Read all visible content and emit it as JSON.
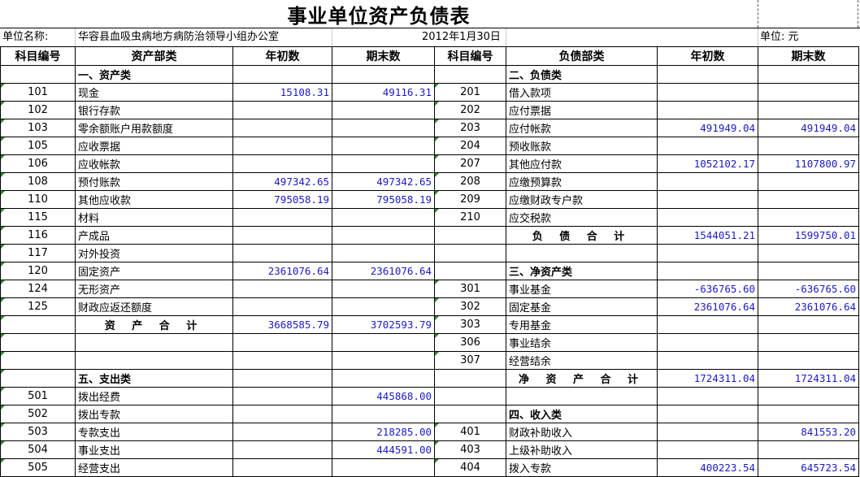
{
  "title": "事业单位资产负债表",
  "info": {
    "unit_label": "单位名称:",
    "unit_name": "华容县血吸虫病地方病防治领导小组办公室",
    "date": "2012年1月30日",
    "currency_label": "单位: 元"
  },
  "headers": [
    "科目编号",
    "资产部类",
    "年初数",
    "期末数",
    "科目编号",
    "负债部类",
    "年初数",
    "期末数"
  ],
  "rows": [
    [
      {
        "t": ""
      },
      {
        "t": "一、资产类",
        "s": "cat"
      },
      {
        "t": ""
      },
      {
        "t": ""
      },
      {
        "t": ""
      },
      {
        "t": "二、负债类",
        "s": "cat"
      },
      {
        "t": ""
      },
      {
        "t": ""
      }
    ],
    [
      {
        "t": "101",
        "s": "code"
      },
      {
        "t": "现金"
      },
      {
        "t": "15108.31",
        "s": "num"
      },
      {
        "t": "49116.31",
        "s": "num"
      },
      {
        "t": "201",
        "s": "code"
      },
      {
        "t": "借入款项"
      },
      {
        "t": ""
      },
      {
        "t": ""
      }
    ],
    [
      {
        "t": "102",
        "s": "code"
      },
      {
        "t": "银行存款"
      },
      {
        "t": ""
      },
      {
        "t": ""
      },
      {
        "t": "202",
        "s": "code"
      },
      {
        "t": "应付票据"
      },
      {
        "t": ""
      },
      {
        "t": ""
      }
    ],
    [
      {
        "t": "103",
        "s": "code"
      },
      {
        "t": "零余额账户用款额度"
      },
      {
        "t": ""
      },
      {
        "t": ""
      },
      {
        "t": "203",
        "s": "code"
      },
      {
        "t": "应付帐款"
      },
      {
        "t": "491949.04",
        "s": "num"
      },
      {
        "t": "491949.04",
        "s": "num"
      }
    ],
    [
      {
        "t": "105",
        "s": "code"
      },
      {
        "t": "应收票据"
      },
      {
        "t": ""
      },
      {
        "t": ""
      },
      {
        "t": "204",
        "s": "code"
      },
      {
        "t": "预收账款"
      },
      {
        "t": ""
      },
      {
        "t": ""
      }
    ],
    [
      {
        "t": "106",
        "s": "code"
      },
      {
        "t": "应收帐款"
      },
      {
        "t": ""
      },
      {
        "t": ""
      },
      {
        "t": "207",
        "s": "code"
      },
      {
        "t": "其他应付款"
      },
      {
        "t": "1052102.17",
        "s": "num"
      },
      {
        "t": "1107800.97",
        "s": "num"
      }
    ],
    [
      {
        "t": "108",
        "s": "code"
      },
      {
        "t": "预付账款"
      },
      {
        "t": "497342.65",
        "s": "num"
      },
      {
        "t": "497342.65",
        "s": "num"
      },
      {
        "t": "208",
        "s": "code"
      },
      {
        "t": "应缴预算款"
      },
      {
        "t": ""
      },
      {
        "t": ""
      }
    ],
    [
      {
        "t": "110",
        "s": "code"
      },
      {
        "t": "其他应收款"
      },
      {
        "t": "795058.19",
        "s": "num"
      },
      {
        "t": "795058.19",
        "s": "num"
      },
      {
        "t": "209",
        "s": "code"
      },
      {
        "t": "应缴财政专户款"
      },
      {
        "t": ""
      },
      {
        "t": ""
      }
    ],
    [
      {
        "t": "115",
        "s": "code"
      },
      {
        "t": "材料"
      },
      {
        "t": ""
      },
      {
        "t": ""
      },
      {
        "t": "210",
        "s": "code"
      },
      {
        "t": "应交税款"
      },
      {
        "t": ""
      },
      {
        "t": ""
      }
    ],
    [
      {
        "t": "116",
        "s": "code"
      },
      {
        "t": "产成品"
      },
      {
        "t": ""
      },
      {
        "t": ""
      },
      {
        "t": ""
      },
      {
        "t": "负 债 合 计",
        "s": "total"
      },
      {
        "t": "1544051.21",
        "s": "num"
      },
      {
        "t": "1599750.01",
        "s": "num"
      }
    ],
    [
      {
        "t": "117",
        "s": "code"
      },
      {
        "t": "对外投资"
      },
      {
        "t": ""
      },
      {
        "t": ""
      },
      {
        "t": ""
      },
      {
        "t": ""
      },
      {
        "t": ""
      },
      {
        "t": ""
      }
    ],
    [
      {
        "t": "120",
        "s": "code"
      },
      {
        "t": "固定资产"
      },
      {
        "t": "2361076.64",
        "s": "num"
      },
      {
        "t": "2361076.64",
        "s": "num"
      },
      {
        "t": ""
      },
      {
        "t": "三、净资产类",
        "s": "cat"
      },
      {
        "t": ""
      },
      {
        "t": ""
      }
    ],
    [
      {
        "t": "124",
        "s": "code"
      },
      {
        "t": "无形资产"
      },
      {
        "t": ""
      },
      {
        "t": ""
      },
      {
        "t": "301",
        "s": "code"
      },
      {
        "t": "事业基金"
      },
      {
        "t": "-636765.60",
        "s": "num"
      },
      {
        "t": "-636765.60",
        "s": "num"
      }
    ],
    [
      {
        "t": "125",
        "s": "code"
      },
      {
        "t": "财政应返还额度"
      },
      {
        "t": ""
      },
      {
        "t": ""
      },
      {
        "t": "302",
        "s": "code"
      },
      {
        "t": "固定基金"
      },
      {
        "t": "2361076.64",
        "s": "num"
      },
      {
        "t": "2361076.64",
        "s": "num"
      }
    ],
    [
      {
        "t": ""
      },
      {
        "t": "资 产 合 计",
        "s": "total"
      },
      {
        "t": "3668585.79",
        "s": "num"
      },
      {
        "t": "3702593.79",
        "s": "num"
      },
      {
        "t": "303",
        "s": "code"
      },
      {
        "t": "专用基金"
      },
      {
        "t": ""
      },
      {
        "t": ""
      }
    ],
    [
      {
        "t": ""
      },
      {
        "t": ""
      },
      {
        "t": ""
      },
      {
        "t": ""
      },
      {
        "t": "306",
        "s": "code"
      },
      {
        "t": "事业结余"
      },
      {
        "t": ""
      },
      {
        "t": ""
      }
    ],
    [
      {
        "t": ""
      },
      {
        "t": ""
      },
      {
        "t": ""
      },
      {
        "t": ""
      },
      {
        "t": "307",
        "s": "code"
      },
      {
        "t": "经营结余"
      },
      {
        "t": ""
      },
      {
        "t": ""
      }
    ],
    [
      {
        "t": ""
      },
      {
        "t": "五、支出类",
        "s": "cat"
      },
      {
        "t": ""
      },
      {
        "t": ""
      },
      {
        "t": ""
      },
      {
        "t": "净 资 产 合 计",
        "s": "total"
      },
      {
        "t": "1724311.04",
        "s": "num"
      },
      {
        "t": "1724311.04",
        "s": "num"
      }
    ],
    [
      {
        "t": "501",
        "s": "code"
      },
      {
        "t": "拨出经费"
      },
      {
        "t": ""
      },
      {
        "t": "445868.00",
        "s": "num"
      },
      {
        "t": ""
      },
      {
        "t": ""
      },
      {
        "t": ""
      },
      {
        "t": ""
      }
    ],
    [
      {
        "t": "502",
        "s": "code"
      },
      {
        "t": "拨出专款"
      },
      {
        "t": ""
      },
      {
        "t": ""
      },
      {
        "t": ""
      },
      {
        "t": "四、收入类",
        "s": "cat"
      },
      {
        "t": ""
      },
      {
        "t": ""
      }
    ],
    [
      {
        "t": "503",
        "s": "code"
      },
      {
        "t": "专款支出"
      },
      {
        "t": ""
      },
      {
        "t": "218285.00",
        "s": "num"
      },
      {
        "t": "401",
        "s": "code"
      },
      {
        "t": "财政补助收入"
      },
      {
        "t": ""
      },
      {
        "t": "841553.20",
        "s": "num"
      }
    ],
    [
      {
        "t": "504",
        "s": "code"
      },
      {
        "t": "事业支出"
      },
      {
        "t": ""
      },
      {
        "t": "444591.00",
        "s": "num"
      },
      {
        "t": "403",
        "s": "code"
      },
      {
        "t": "上级补助收入"
      },
      {
        "t": ""
      },
      {
        "t": ""
      }
    ],
    [
      {
        "t": "505",
        "s": "code"
      },
      {
        "t": "经营支出"
      },
      {
        "t": ""
      },
      {
        "t": ""
      },
      {
        "t": "404",
        "s": "code"
      },
      {
        "t": "拨入专款"
      },
      {
        "t": "400223.54",
        "s": "num"
      },
      {
        "t": "645723.54",
        "s": "num"
      }
    ]
  ]
}
